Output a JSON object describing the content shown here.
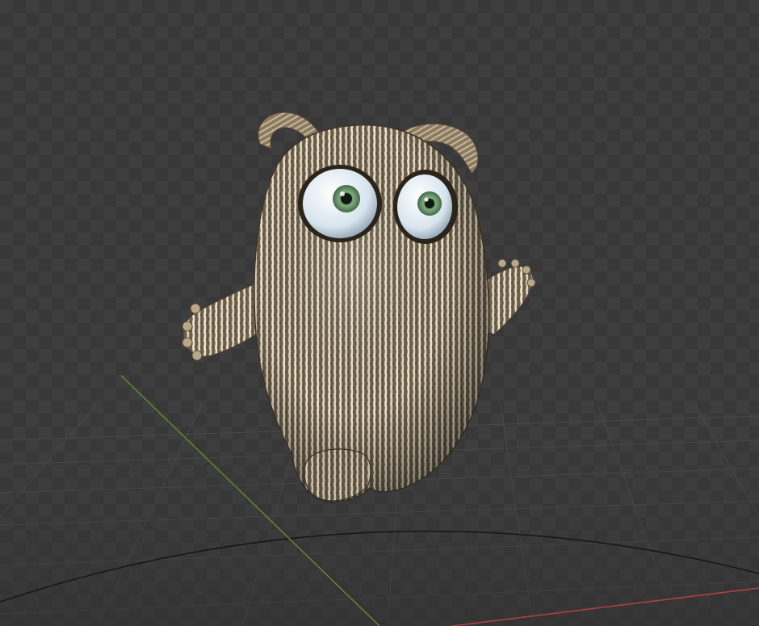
{
  "viewport": {
    "background": "#3a3a3a",
    "checker_dark": "#363636",
    "checker_light": "#3d3d3d",
    "grid_color": "#4a4a4a",
    "axis_x_color": "#c44a4a",
    "axis_y_color": "#6a9a3a",
    "horizon_color": "#1a1a1a"
  },
  "model": {
    "name": "knitted-monster",
    "knit_light": "#e8dcc4",
    "knit_dark": "#5a4e3e",
    "eye_iris": "#7fa67a",
    "eye_white": "#e6eef5"
  }
}
